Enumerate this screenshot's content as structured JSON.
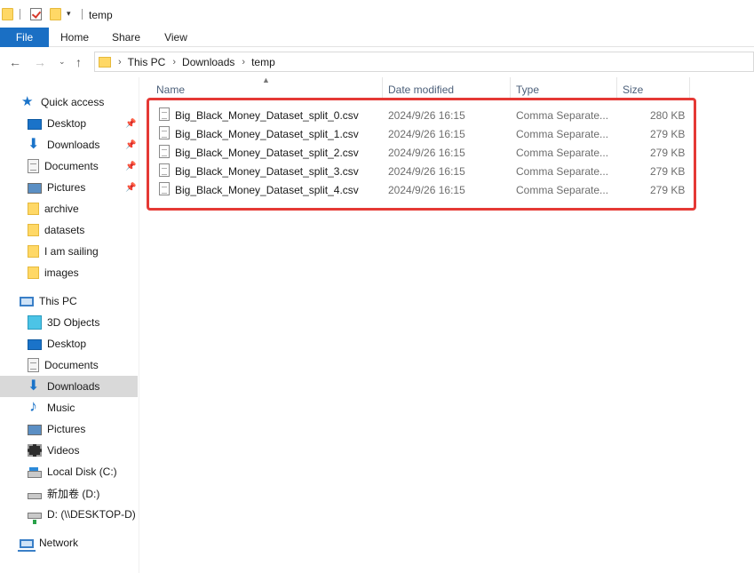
{
  "window": {
    "title": "temp"
  },
  "ribbon": {
    "tabs": [
      "File",
      "Home",
      "Share",
      "View"
    ]
  },
  "address": {
    "breadcrumbs": [
      "This PC",
      "Downloads",
      "temp"
    ]
  },
  "navpane": {
    "quick_access": {
      "label": "Quick access",
      "items": [
        {
          "label": "Desktop",
          "icon": "desktop-icon",
          "pinned": true
        },
        {
          "label": "Downloads",
          "icon": "downloads-icon",
          "pinned": true
        },
        {
          "label": "Documents",
          "icon": "documents-icon",
          "pinned": true
        },
        {
          "label": "Pictures",
          "icon": "pictures-icon",
          "pinned": true
        },
        {
          "label": "archive",
          "icon": "folder-icon",
          "pinned": false
        },
        {
          "label": "datasets",
          "icon": "folder-icon",
          "pinned": false
        },
        {
          "label": "I am sailing",
          "icon": "folder-icon",
          "pinned": false
        },
        {
          "label": "images",
          "icon": "folder-icon",
          "pinned": false
        }
      ]
    },
    "this_pc": {
      "label": "This PC",
      "items": [
        {
          "label": "3D Objects",
          "icon": "3d-objects-icon"
        },
        {
          "label": "Desktop",
          "icon": "desktop-icon"
        },
        {
          "label": "Documents",
          "icon": "documents-icon"
        },
        {
          "label": "Downloads",
          "icon": "downloads-icon",
          "selected": true
        },
        {
          "label": "Music",
          "icon": "music-icon"
        },
        {
          "label": "Pictures",
          "icon": "pictures-icon"
        },
        {
          "label": "Videos",
          "icon": "videos-icon"
        },
        {
          "label": "Local Disk (C:)",
          "icon": "local-disk-icon"
        },
        {
          "label": "新加卷 (D:)",
          "icon": "drive-icon"
        },
        {
          "label": "D: (\\\\DESKTOP-D) (I",
          "icon": "network-drive-icon"
        }
      ]
    },
    "network": {
      "label": "Network"
    }
  },
  "filelist": {
    "columns": {
      "name": "Name",
      "date": "Date modified",
      "type": "Type",
      "size": "Size"
    },
    "rows": [
      {
        "name": "Big_Black_Money_Dataset_split_0.csv",
        "date": "2024/9/26 16:15",
        "type": "Comma Separate...",
        "size": "280 KB"
      },
      {
        "name": "Big_Black_Money_Dataset_split_1.csv",
        "date": "2024/9/26 16:15",
        "type": "Comma Separate...",
        "size": "279 KB"
      },
      {
        "name": "Big_Black_Money_Dataset_split_2.csv",
        "date": "2024/9/26 16:15",
        "type": "Comma Separate...",
        "size": "279 KB"
      },
      {
        "name": "Big_Black_Money_Dataset_split_3.csv",
        "date": "2024/9/26 16:15",
        "type": "Comma Separate...",
        "size": "279 KB"
      },
      {
        "name": "Big_Black_Money_Dataset_split_4.csv",
        "date": "2024/9/26 16:15",
        "type": "Comma Separate...",
        "size": "279 KB"
      }
    ]
  },
  "colors": {
    "accent": "#1a6fc4",
    "selection": "#d9d9d9",
    "highlight_border": "#e53935"
  }
}
